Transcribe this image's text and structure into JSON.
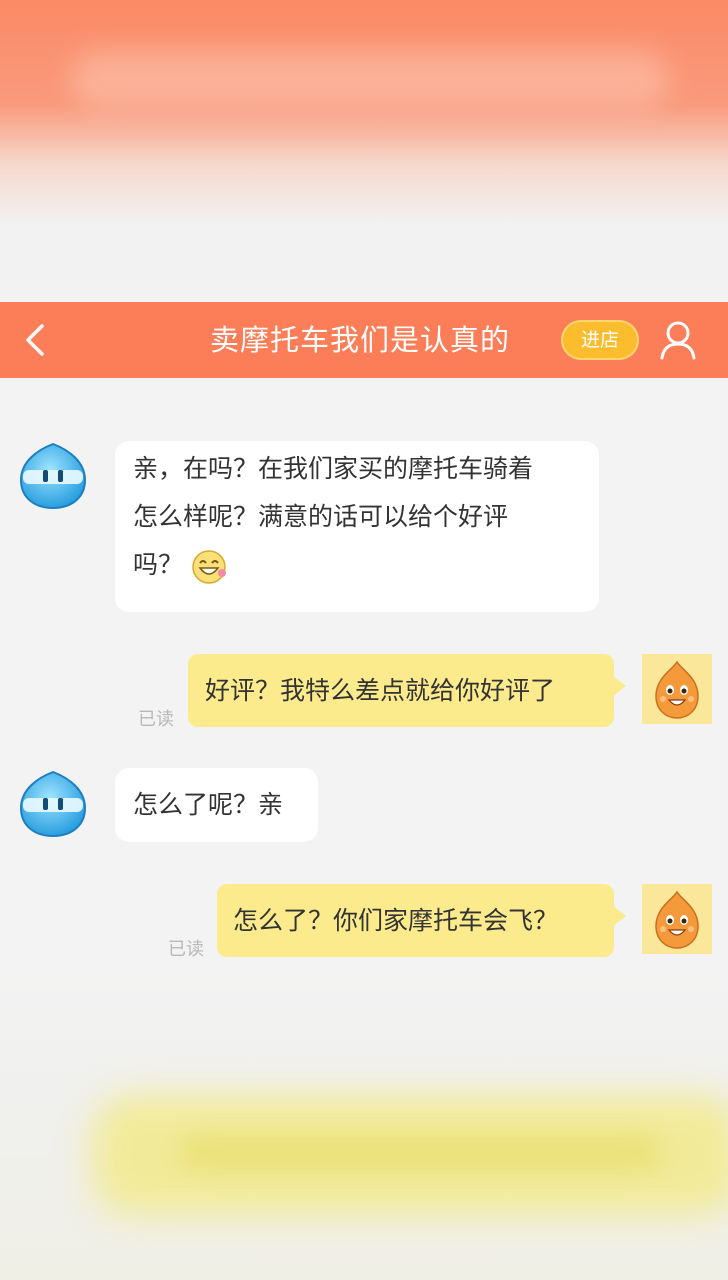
{
  "header": {
    "title": "卖摩托车我们是认真的",
    "store_label": "进店",
    "color": "#fb7e58"
  },
  "messages": [
    {
      "side": "left",
      "lines": [
        "亲，在吗？在我们家买的摩托车骑着",
        "怎么样呢？满意的话可以给个好评",
        "吗？"
      ],
      "emoji": "grinning-emoji"
    },
    {
      "side": "right",
      "text": "好评？我特么差点就给你好评了",
      "status": "已读"
    },
    {
      "side": "left",
      "text": "怎么了呢？亲"
    },
    {
      "side": "right",
      "text": "怎么了？你们家摩托车会飞？",
      "status": "已读"
    }
  ],
  "icons": {
    "back": "chevron-left-icon",
    "user": "user-icon",
    "seller_avatar": "blue-droplet-avatar",
    "buyer_avatar": "orange-mascot-avatar"
  },
  "colors": {
    "sent_bubble": "#fbeb8c",
    "received_bubble": "#ffffff",
    "store_button": "#fbbd2e"
  }
}
